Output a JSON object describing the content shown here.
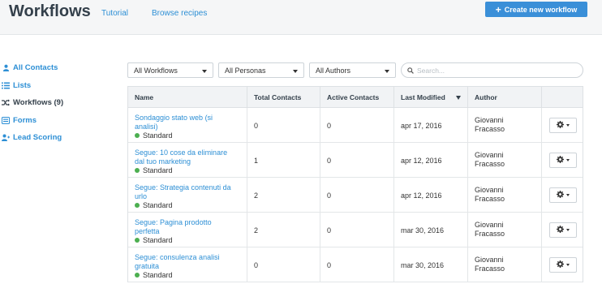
{
  "header": {
    "title": "Workflows",
    "links": [
      "Tutorial",
      "Browse recipes"
    ],
    "create_label": "Create new workflow"
  },
  "sidebar": {
    "items": [
      {
        "label": "All Contacts",
        "icon": "person-icon",
        "active": false
      },
      {
        "label": "Lists",
        "icon": "list-icon",
        "active": false
      },
      {
        "label": "Workflows (9)",
        "icon": "shuffle-icon",
        "active": true
      },
      {
        "label": "Forms",
        "icon": "form-icon",
        "active": false
      },
      {
        "label": "Lead Scoring",
        "icon": "person-plus-icon",
        "active": false
      }
    ]
  },
  "filters": {
    "workflows": "All Workflows",
    "personas": "All Personas",
    "authors": "All Authors",
    "search_placeholder": "Search..."
  },
  "table": {
    "columns": [
      "Name",
      "Total Contacts",
      "Active Contacts",
      "Last Modified",
      "Author"
    ],
    "sorted_column": "Last Modified",
    "rows": [
      {
        "name": "Sondaggio stato web (si analisi)",
        "type": "Standard",
        "total": "0",
        "active": "0",
        "modified": "apr 17, 2016",
        "author": "Giovanni Fracasso"
      },
      {
        "name": "Segue: 10 cose da eliminare dal tuo marketing",
        "type": "Standard",
        "total": "1",
        "active": "0",
        "modified": "apr 12, 2016",
        "author": "Giovanni Fracasso"
      },
      {
        "name": "Segue: Strategia contenuti da urlo",
        "type": "Standard",
        "total": "2",
        "active": "0",
        "modified": "apr 12, 2016",
        "author": "Giovanni Fracasso"
      },
      {
        "name": "Segue: Pagina prodotto perfetta",
        "type": "Standard",
        "total": "2",
        "active": "0",
        "modified": "mar 30, 2016",
        "author": "Giovanni Fracasso"
      },
      {
        "name": "Segue: consulenza analisi gratuita",
        "type": "Standard",
        "total": "0",
        "active": "0",
        "modified": "mar 30, 2016",
        "author": "Giovanni Fracasso"
      }
    ]
  },
  "colors": {
    "accent": "#3a8fd8",
    "link": "#2d8fd5",
    "status_standard": "#4caf50"
  }
}
